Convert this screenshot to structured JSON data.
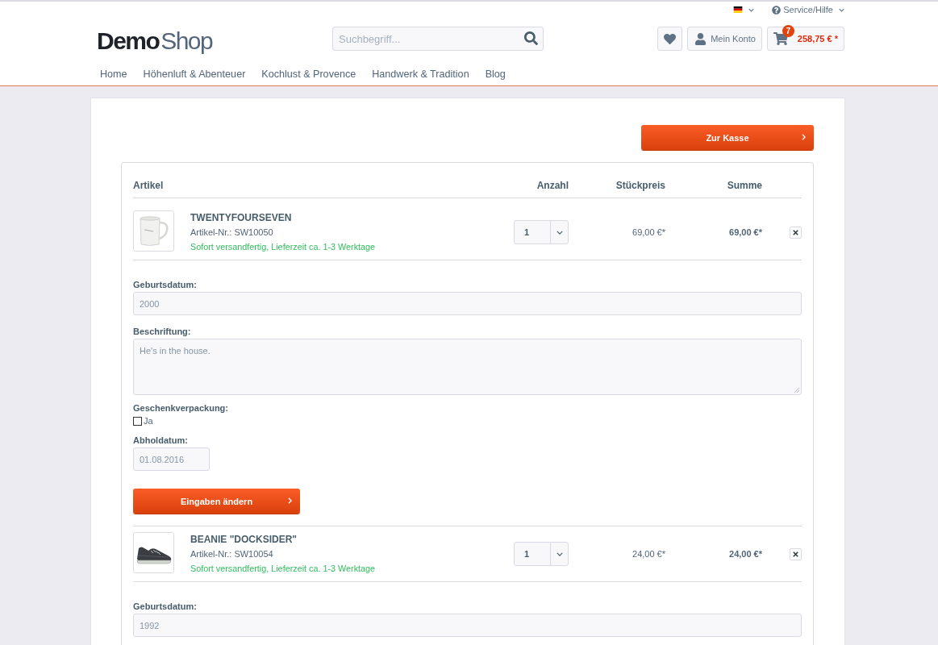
{
  "top_bar": {
    "service": {
      "label": "Service/Hilfe"
    }
  },
  "logo": {
    "primary": "Demo",
    "secondary": "Shop"
  },
  "search": {
    "placeholder": "Suchbegriff..."
  },
  "account": {
    "label": "Mein Konto"
  },
  "cart": {
    "count": "7",
    "total": "258,75 € *"
  },
  "nav": [
    {
      "label": "Home"
    },
    {
      "label": "Höhenluft & Abenteuer"
    },
    {
      "label": "Kochlust & Provence"
    },
    {
      "label": "Handwerk & Tradition"
    },
    {
      "label": "Blog"
    }
  ],
  "checkout_button": {
    "label": "Zur Kasse"
  },
  "table": {
    "columns": [
      "Artikel",
      "Anzahl",
      "Stückpreis",
      "Summe"
    ],
    "items": [
      {
        "kind": "mug",
        "name": "TWENTYFOURSEVEN",
        "sku": "Artikel-Nr.: SW10050",
        "delivery": "Sofort versandfertig, Lieferzeit ca. 1-3 Werktage",
        "quantity": "1",
        "unit_price": "69,00 €*",
        "total": "69,00 €*",
        "fields": [
          {
            "kind": "text",
            "label": "Geburtsdatum:",
            "value": "2000"
          },
          {
            "kind": "textarea",
            "label": "Beschriftung:",
            "value": "He's in the house."
          },
          {
            "kind": "checkbox",
            "label": "Geschenkverpackung:",
            "option": "Ja",
            "checked": false
          },
          {
            "kind": "date",
            "label": "Abholdatum:",
            "value": "01.08.2016"
          }
        ],
        "submit": "Eingaben ändern"
      },
      {
        "kind": "shoe",
        "name": "BEANIE \"DOCKSIDER\"",
        "sku": "Artikel-Nr.: SW10054",
        "delivery": "Sofort versandfertig, Lieferzeit ca. 1-3 Werktage",
        "quantity": "1",
        "unit_price": "24,00 €*",
        "total": "24,00 €*",
        "fields": [
          {
            "kind": "text",
            "label": "Geburtsdatum:",
            "value": "1992"
          }
        ]
      }
    ]
  }
}
